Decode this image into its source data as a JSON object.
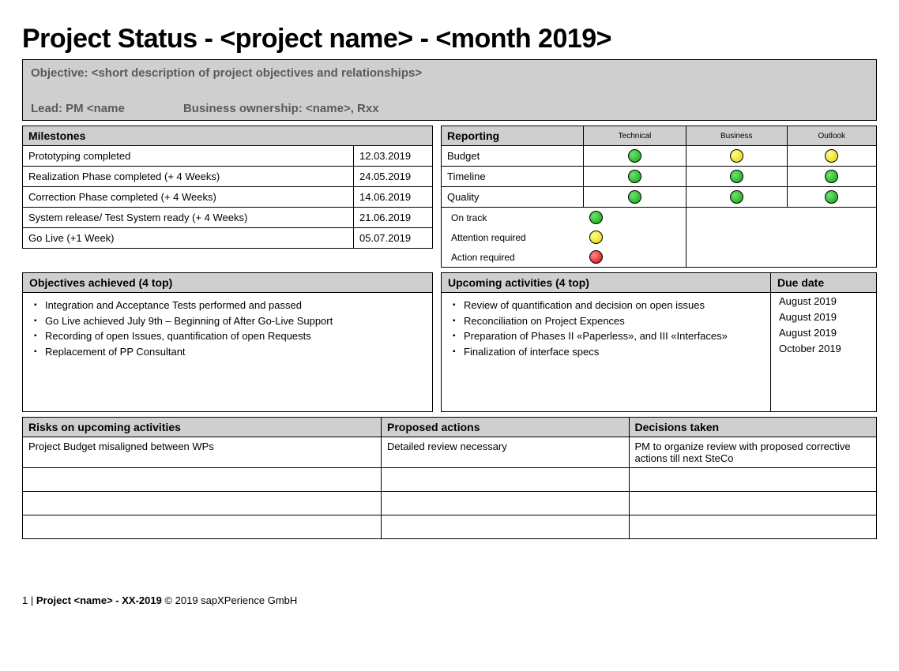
{
  "title": "Project Status - <project name> - <month 2019>",
  "objective_label": "Objective: <short description of project objectives and relationships>",
  "lead_label": "Lead: PM <name",
  "ownership_label": "Business ownership: <name>, Rxx",
  "milestones": {
    "header": "Milestones",
    "rows": [
      {
        "name": "Prototyping completed",
        "date": "12.03.2019"
      },
      {
        "name": "Realization Phase completed (+ 4 Weeks)",
        "date": "24.05.2019"
      },
      {
        "name": "Correction Phase completed (+ 4 Weeks)",
        "date": "14.06.2019"
      },
      {
        "name": "System release/ Test System ready (+ 4 Weeks)",
        "date": "21.06.2019"
      },
      {
        "name": "Go Live (+1 Week)",
        "date": "05.07.2019"
      }
    ]
  },
  "reporting": {
    "header": "Reporting",
    "col1": "Technical",
    "col2": "Business",
    "col3": "Outlook",
    "rows": [
      {
        "label": "Budget",
        "c1": "green",
        "c2": "yellow",
        "c3": "yellow"
      },
      {
        "label": "Timeline",
        "c1": "green",
        "c2": "green",
        "c3": "green"
      },
      {
        "label": "Quality",
        "c1": "green",
        "c2": "green",
        "c3": "green"
      }
    ],
    "legend": [
      {
        "label": "On track",
        "color": "green"
      },
      {
        "label": "Attention required",
        "color": "yellow"
      },
      {
        "label": "Action required",
        "color": "red"
      }
    ]
  },
  "objectives_achieved": {
    "header": "Objectives achieved (4 top)",
    "items": [
      "Integration and Acceptance Tests performed and passed",
      "Go Live achieved July 9th – Beginning of  After Go-Live Support",
      "Recording of open Issues, quantification of open Requests",
      "Replacement of PP Consultant"
    ]
  },
  "upcoming": {
    "header": "Upcoming activities (4 top)",
    "due_header": "Due date",
    "items": [
      {
        "text": "Review of quantification and decision on open issues",
        "due": "August 2019"
      },
      {
        "text": "Reconciliation on Project Expences",
        "due": "August 2019"
      },
      {
        "text": "Preparation of Phases II «Paperless», and III «Interfaces»",
        "due": "August 2019"
      },
      {
        "text": "Finalization of interface specs",
        "due": "October 2019"
      }
    ]
  },
  "risks": {
    "h1": "Risks on upcoming activities",
    "h2": "Proposed actions",
    "h3": "Decisions taken",
    "rows": [
      {
        "risk": "Project Budget misaligned between WPs",
        "action": "Detailed review necessary",
        "decision": "PM to organize review with proposed corrective actions till next SteCo"
      },
      {
        "risk": "",
        "action": "",
        "decision": ""
      },
      {
        "risk": "",
        "action": "",
        "decision": ""
      },
      {
        "risk": "",
        "action": "",
        "decision": ""
      }
    ]
  },
  "footer": {
    "page": "1",
    "sep": " | ",
    "project": "Project <name> - XX-2019",
    "copyright": "  © 2019 sapXPerience GmbH"
  }
}
